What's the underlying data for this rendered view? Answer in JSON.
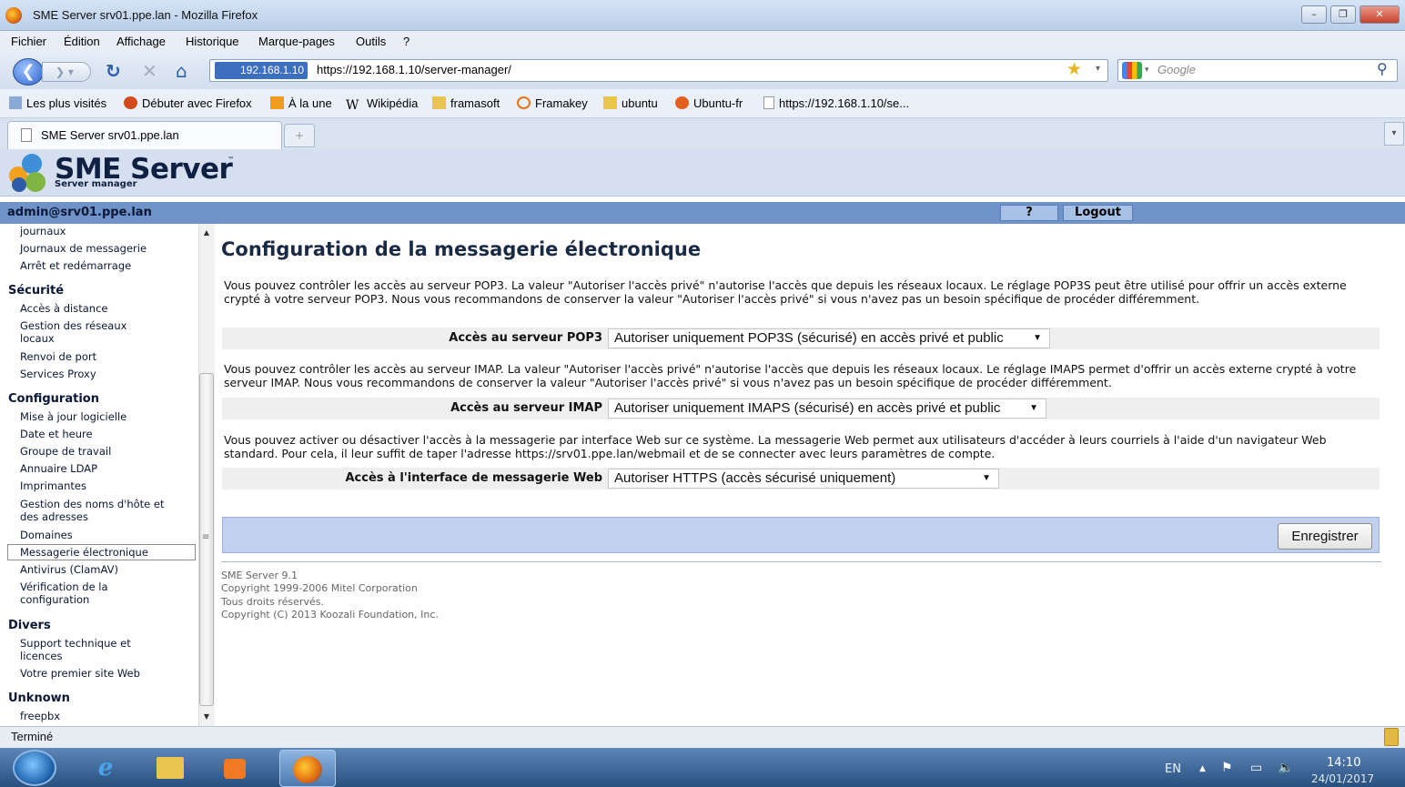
{
  "window": {
    "title": "SME Server srv01.ppe.lan - Mozilla Firefox"
  },
  "menu": [
    "Fichier",
    "Édition",
    "Affichage",
    "Historique",
    "Marque-pages",
    "Outils",
    "?"
  ],
  "nav": {
    "url_site": "192.168.1.10",
    "url": "https://192.168.1.10/server-manager/",
    "search_placeholder": "Google"
  },
  "bookmarks": [
    "Les plus visités",
    "Débuter avec Firefox",
    "À la une",
    "Wikipédia",
    "framasoft",
    "Framakey",
    "ubuntu",
    "Ubuntu-fr",
    "https://192.168.1.10/se..."
  ],
  "tab": {
    "label": "SME Server srv01.ppe.lan"
  },
  "header": {
    "logo_name": "SME Server",
    "logo_tm": "™",
    "logo_sub": "Server manager"
  },
  "userbar": {
    "user": "admin@srv01.ppe.lan",
    "help": "?",
    "logout": "Logout"
  },
  "sidebar": {
    "top_items": [
      "journaux",
      "Journaux de messagerie",
      "Arrêt et redémarrage"
    ],
    "security_title": "Sécurité",
    "security_items": [
      "Accès à distance",
      "Gestion des réseaux locaux",
      "Renvoi de port",
      "Services Proxy"
    ],
    "config_title": "Configuration",
    "config_items": [
      "Mise à jour logicielle",
      "Date et heure",
      "Groupe de travail",
      "Annuaire LDAP",
      "Imprimantes",
      "Gestion des noms d'hôte et des adresses",
      "Domaines",
      "Messagerie électronique",
      "Antivirus (ClamAV)",
      "Vérification de la configuration"
    ],
    "misc_title": "Divers",
    "misc_items": [
      "Support technique et licences",
      "Votre premier site Web"
    ],
    "unknown_title": "Unknown",
    "unknown_items": [
      "freepbx"
    ]
  },
  "main": {
    "title": "Configuration de la messagerie électronique",
    "pop3_desc": "Vous pouvez contrôler les accès au serveur POP3. La valeur \"Autoriser l'accès privé\" n'autorise l'accès que depuis les réseaux locaux. Le réglage POP3S peut être utilisé pour offrir un accès externe crypté à votre serveur POP3. Nous vous recommandons de conserver la valeur \"Autoriser l'accès privé\" si vous n'avez pas un besoin spécifique de procéder différemment.",
    "pop3_label": "Accès au serveur POP3",
    "pop3_value": "Autoriser uniquement POP3S (sécurisé) en accès privé et public",
    "imap_desc": "Vous pouvez contrôler les accès au serveur IMAP. La valeur \"Autoriser l'accès privé\" n'autorise l'accès que depuis les réseaux locaux. Le réglage IMAPS permet d'offrir un accès externe crypté à votre serveur IMAP. Nous vous recommandons de conserver la valeur \"Autoriser l'accès privé\" si vous n'avez pas un besoin spécifique de procéder différemment.",
    "imap_label": "Accès au serveur IMAP",
    "imap_value": "Autoriser uniquement IMAPS (sécurisé) en accès privé et public",
    "web_desc": "Vous pouvez activer ou désactiver l'accès à la messagerie par interface Web sur ce système. La messagerie Web permet aux utilisateurs d'accéder à leurs courriels à l'aide d'un navigateur Web standard. Pour cela, il leur suffit de taper l'adresse https://srv01.ppe.lan/webmail et de se connecter avec leurs paramètres de compte.",
    "web_label": "Accès à l'interface de messagerie Web",
    "web_value": "Autoriser HTTPS (accès sécurisé uniquement)",
    "save": "Enregistrer"
  },
  "footer": [
    "SME Server 9.1",
    "Copyright 1999-2006 Mitel Corporation",
    "Tous droits réservés.",
    "Copyright (C) 2013 Koozali Foundation, Inc."
  ],
  "status": {
    "text": "Terminé"
  },
  "taskbar": {
    "lang": "EN",
    "time": "14:10",
    "date": "24/01/2017"
  }
}
